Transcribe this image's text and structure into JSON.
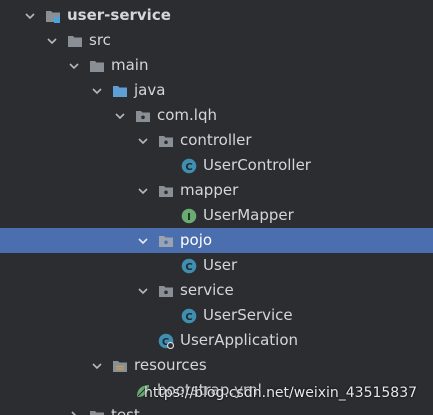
{
  "tree": {
    "root_label": "user-service",
    "src_label": "src",
    "main_label": "main",
    "java_label": "java",
    "package_label": "com.lqh",
    "controller_label": "controller",
    "user_controller_label": "UserController",
    "mapper_label": "mapper",
    "user_mapper_label": "UserMapper",
    "pojo_label": "pojo",
    "user_label": "User",
    "service_label": "service",
    "user_service_label": "UserService",
    "user_application_label": "UserApplication",
    "resources_label": "resources",
    "bootstrap_label": "bootstrap.yml",
    "test_label": "test"
  },
  "watermark": {
    "text": "https://blog.csdn.net/weixin_43515837"
  },
  "colors": {
    "background": "#2b2d30",
    "selection": "#4b6eaf",
    "text": "#d4d6da",
    "folder": "#8a8f96",
    "source_folder": "#5f9fd6",
    "class_icon": "#3e8fb0",
    "interface_icon": "#6aab73"
  }
}
